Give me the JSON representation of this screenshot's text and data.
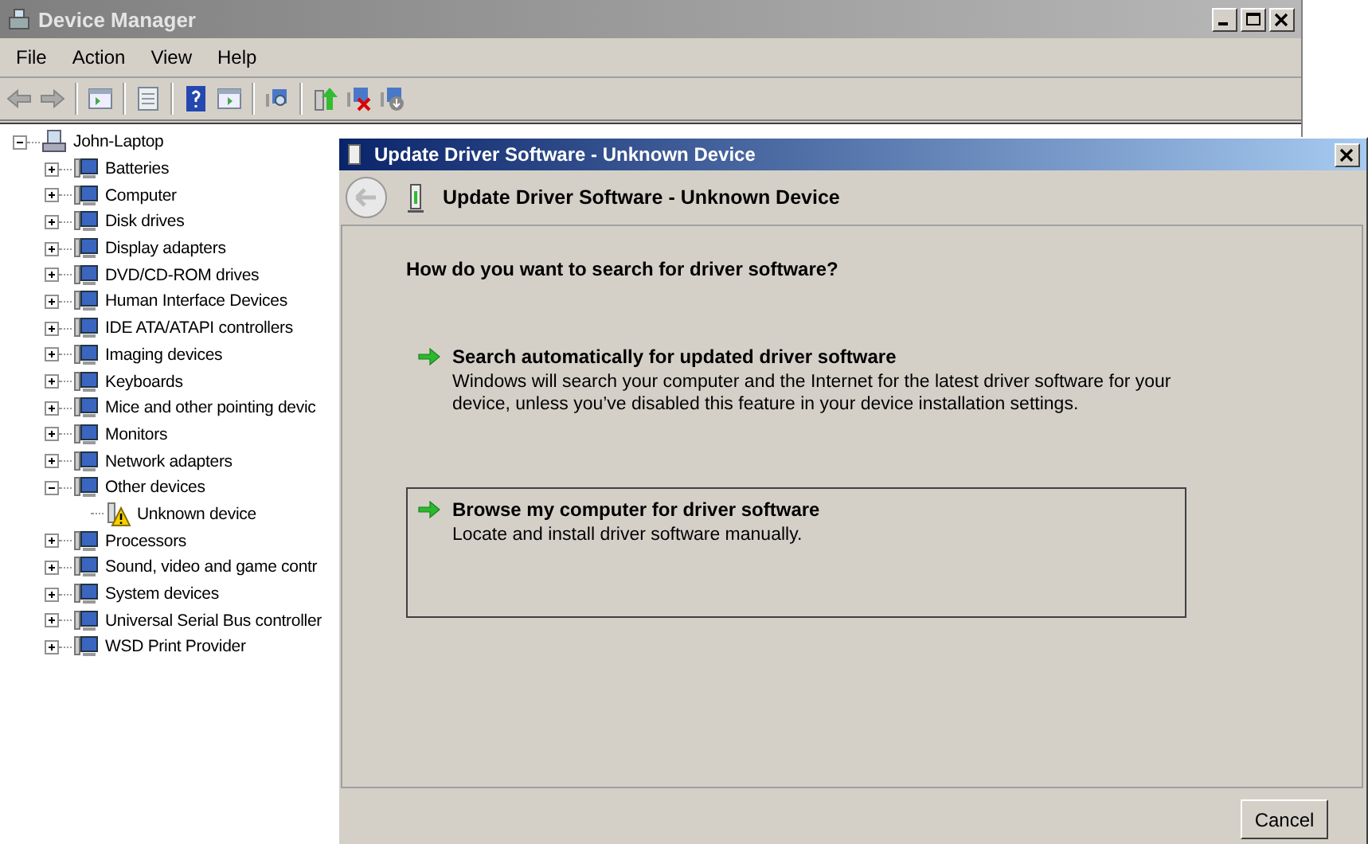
{
  "window": {
    "title": "Device Manager"
  },
  "menu": [
    "File",
    "Action",
    "View",
    "Help"
  ],
  "tree": {
    "label": "John-Laptop",
    "expanded": true,
    "children": [
      {
        "label": "Batteries",
        "expanded": false
      },
      {
        "label": "Computer",
        "expanded": false
      },
      {
        "label": "Disk drives",
        "expanded": false
      },
      {
        "label": "Display adapters",
        "expanded": false
      },
      {
        "label": "DVD/CD-ROM drives",
        "expanded": false
      },
      {
        "label": "Human Interface Devices",
        "expanded": false
      },
      {
        "label": "IDE ATA/ATAPI controllers",
        "expanded": false
      },
      {
        "label": "Imaging devices",
        "expanded": false
      },
      {
        "label": "Keyboards",
        "expanded": false
      },
      {
        "label": "Mice and other pointing devic",
        "expanded": false
      },
      {
        "label": "Monitors",
        "expanded": false
      },
      {
        "label": "Network adapters",
        "expanded": false
      },
      {
        "label": "Other devices",
        "expanded": true,
        "children": [
          {
            "label": "Unknown device",
            "warning": true
          }
        ]
      },
      {
        "label": "Processors",
        "expanded": false
      },
      {
        "label": "Sound, video and game contr",
        "expanded": false
      },
      {
        "label": "System devices",
        "expanded": false
      },
      {
        "label": "Universal Serial Bus controller",
        "expanded": false
      },
      {
        "label": "WSD Print Provider",
        "expanded": false
      }
    ]
  },
  "dialog": {
    "title": "Update Driver Software - Unknown Device",
    "heading": "Update Driver Software - Unknown Device",
    "question": "How do you want to search for driver software?",
    "options": [
      {
        "title": "Search automatically for updated driver software",
        "description": "Windows will search your computer and the Internet for the latest driver software for your device, unless you’ve disabled this feature in your device installation settings.",
        "selected": false
      },
      {
        "title": "Browse my computer for driver software",
        "description": "Locate and install driver software manually.",
        "selected": true
      }
    ],
    "buttons": [
      "Cancel"
    ]
  }
}
